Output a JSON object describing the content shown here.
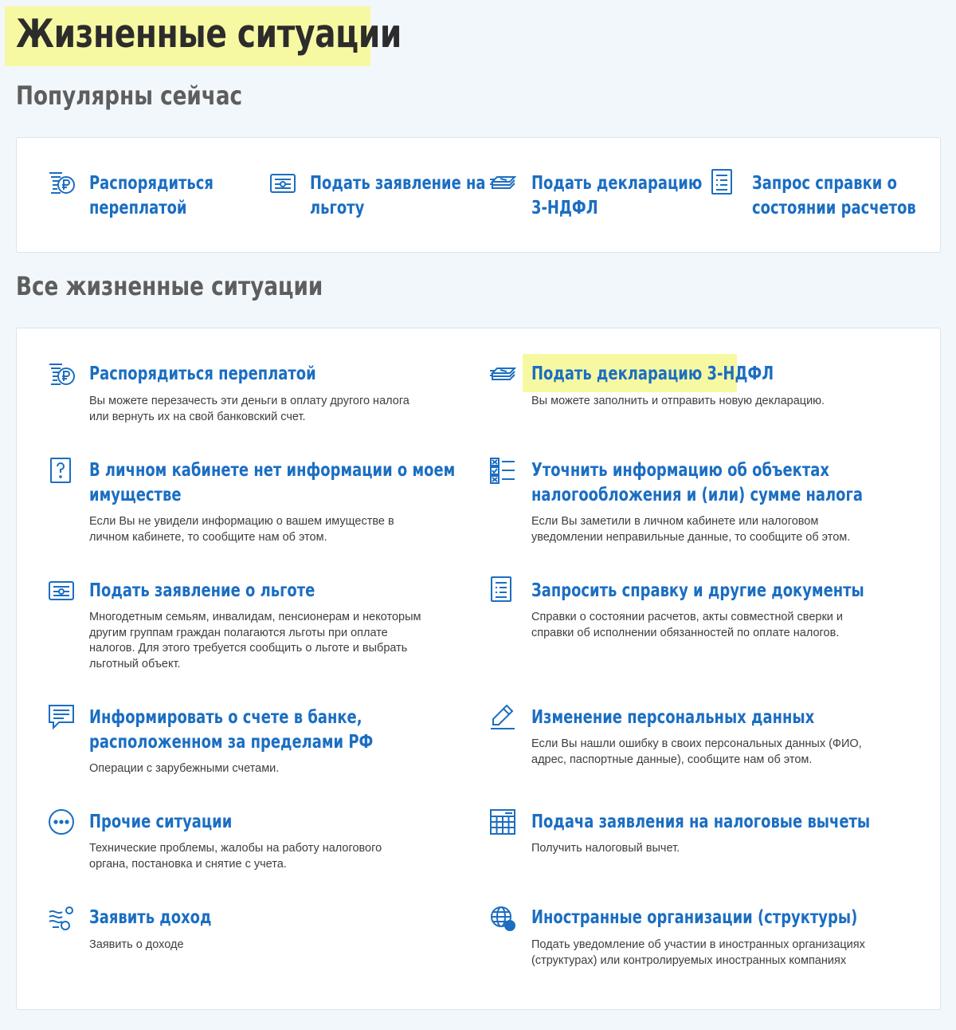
{
  "page_title": "Жизненные ситуации",
  "popular": {
    "heading": "Популярны сейчас",
    "items": [
      {
        "line1": "Распорядиться",
        "line2": "переплатой",
        "icon": "overpayment-ruble-icon"
      },
      {
        "line1": "Подать заявление на",
        "line2": "льготу",
        "icon": "benefit-card-icon"
      },
      {
        "line1": "Подать декларацию",
        "line2": "3-НДФЛ",
        "icon": "declaration-stack-icon"
      },
      {
        "line1": "Запрос справки о",
        "line2": "состоянии расчетов",
        "icon": "document-list-icon"
      }
    ]
  },
  "all": {
    "heading": "Все жизненные ситуации",
    "items": [
      {
        "title1": "Распорядиться переплатой",
        "title2": "",
        "desc": "Вы можете перезачесть эти деньги в оплату другого налога или вернуть их на свой банковский счет.",
        "icon": "overpayment-ruble-icon"
      },
      {
        "title1": "Подать декларацию 3-НДФЛ",
        "title2": "",
        "desc": "Вы можете заполнить и отправить новую декларацию.",
        "icon": "declaration-stack-icon"
      },
      {
        "title1": "В личном кабинете нет информации о моем",
        "title2": "имуществе",
        "desc": "Если Вы не увидели информацию о вашем имуществе в личном кабинете, то сообщите нам об этом.",
        "icon": "question-document-icon"
      },
      {
        "title1": "Уточнить информацию об объектах",
        "title2": "налогообложения и (или) сумме налога",
        "desc": "Если Вы заметили в личном кабинете или налоговом уведомлении неправильные данные, то сообщите об этом.",
        "icon": "checklist-icon"
      },
      {
        "title1": "Подать заявление о льготе",
        "title2": "",
        "desc": "Многодетным семьям, инвалидам, пенсионерам и некоторым другим группам граждан полагаются льготы при оплате налогов. Для этого требуется сообщить о льготе и выбрать льготный объект.",
        "icon": "benefit-card-icon"
      },
      {
        "title1": "Запросить справку и другие документы",
        "title2": "",
        "desc": "Справки о состоянии расчетов, акты совместной сверки и справки об исполнении обязанностей по оплате налогов.",
        "icon": "document-list-icon"
      },
      {
        "title1": "Информировать о счете в банке,",
        "title2": "расположенном за пределами РФ",
        "desc": "Операции с зарубежными счетами.",
        "icon": "message-icon"
      },
      {
        "title1": "Изменение персональных данных",
        "title2": "",
        "desc": "Если Вы нашли ошибку в своих персональных данных (ФИО, адрес, паспортные данные), сообщите нам об этом.",
        "icon": "pencil-icon"
      },
      {
        "title1": "Прочие ситуации",
        "title2": "",
        "desc": "Технические проблемы, жалобы на работу налогового органа, постановка и снятие с учета.",
        "icon": "more-dots-icon"
      },
      {
        "title1": "Подача заявления на налоговые вычеты",
        "title2": "",
        "desc": "Получить налоговый вычет.",
        "icon": "calculator-icon"
      },
      {
        "title1": "Заявить доход",
        "title2": "",
        "desc": "Заявить о доходе",
        "icon": "income-icon"
      },
      {
        "title1": "Иностранные организации (структуры)",
        "title2": "",
        "desc": "Подать уведомление об участии в иностранных организациях (структурах) или контролируемых иностранных компаниях",
        "icon": "globe-icon"
      }
    ]
  },
  "colors": {
    "link": "#1b6ec2",
    "highlight": "#f7f9a2",
    "background": "#f2f7fb"
  }
}
